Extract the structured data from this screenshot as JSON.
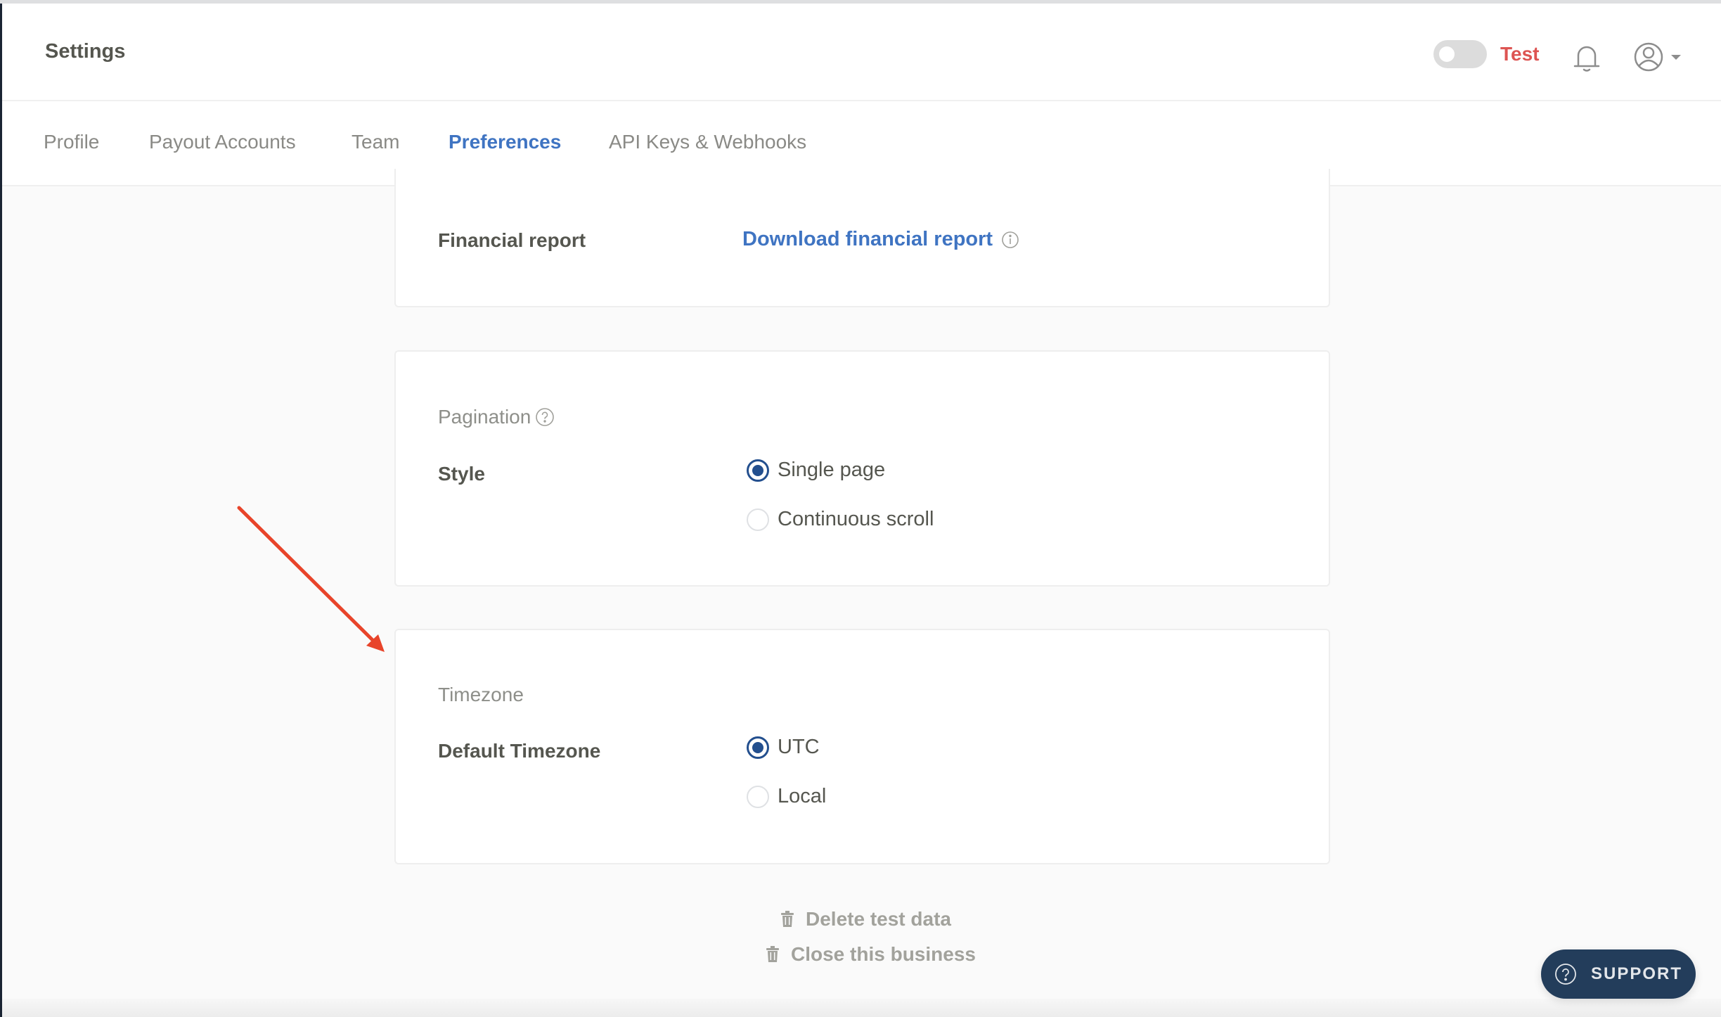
{
  "header": {
    "title": "Settings",
    "mode_toggle": {
      "label": "Test",
      "on": false,
      "label_color": "#dd5452"
    },
    "icons": {
      "notifications": "bell-icon",
      "account": "user-circle-icon",
      "account_menu": "caret-down-icon"
    }
  },
  "tabs": [
    {
      "label": "Profile",
      "active": false
    },
    {
      "label": "Payout Accounts",
      "active": false
    },
    {
      "label": "Team",
      "active": false
    },
    {
      "label": "Preferences",
      "active": true
    },
    {
      "label": "API Keys & Webhooks",
      "active": false
    }
  ],
  "accent_color": "#3f74c2",
  "financial_report": {
    "label": "Financial report",
    "link": "Download financial report",
    "info_icon": "info-icon"
  },
  "pagination": {
    "title": "Pagination",
    "help_icon": "question-circle-icon",
    "field_label": "Style",
    "options": [
      {
        "label": "Single page",
        "checked": true
      },
      {
        "label": "Continuous scroll",
        "checked": false
      }
    ]
  },
  "timezone": {
    "title": "Timezone",
    "field_label": "Default Timezone",
    "options": [
      {
        "label": "UTC",
        "checked": true
      },
      {
        "label": "Local",
        "checked": false
      }
    ]
  },
  "footer_actions": {
    "delete_test_data": "Delete test data",
    "close_business": "Close this business",
    "icon": "trash-icon"
  },
  "support": {
    "label": "SUPPORT",
    "icon": "question-circle-icon"
  },
  "annotation": {
    "type": "arrow",
    "color": "#e8442a",
    "points_to": "Timezone card"
  }
}
